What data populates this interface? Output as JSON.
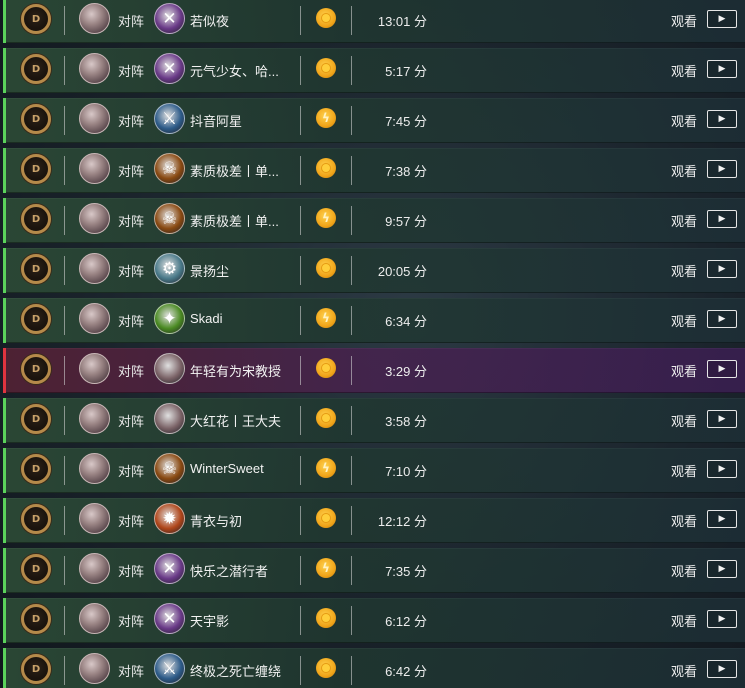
{
  "matches": [
    {
      "vs": "对阵",
      "opponent": "若似夜",
      "hero_icon": "crossed-blades-icon",
      "hero_glyph": "✕",
      "hero_color": "#6a3a88",
      "currency_icon": "gold-coin-icon",
      "duration": "13:01 分",
      "watch": "观看",
      "play": "▶",
      "result": "win"
    },
    {
      "vs": "对阵",
      "opponent": "元气少女、哈...",
      "hero_icon": "crossed-blades-icon",
      "hero_glyph": "✕",
      "hero_color": "#6a3a88",
      "currency_icon": "gold-coin-icon",
      "duration": "5:17 分",
      "watch": "观看",
      "play": "▶",
      "result": "win"
    },
    {
      "vs": "对阵",
      "opponent": "抖音阿星",
      "hero_icon": "sword-icon",
      "hero_glyph": "⚔",
      "hero_color": "#2e5c8a",
      "currency_icon": "flame-coin-icon",
      "duration": "7:45 分",
      "watch": "观看",
      "play": "▶",
      "result": "win"
    },
    {
      "vs": "对阵",
      "opponent": "素质极差丨单...",
      "hero_icon": "demon-mask-icon",
      "hero_glyph": "☠",
      "hero_color": "#8a4a12",
      "currency_icon": "gold-coin-icon",
      "duration": "7:38 分",
      "watch": "观看",
      "play": "▶",
      "result": "win"
    },
    {
      "vs": "对阵",
      "opponent": "素质极差丨单...",
      "hero_icon": "demon-mask-icon",
      "hero_glyph": "☠",
      "hero_color": "#8a4a12",
      "currency_icon": "flame-coin-icon",
      "duration": "9:57 分",
      "watch": "观看",
      "play": "▶",
      "result": "win"
    },
    {
      "vs": "对阵",
      "opponent": "景扬尘",
      "hero_icon": "mech-icon",
      "hero_glyph": "⚙",
      "hero_color": "#4a7a8a",
      "currency_icon": "gold-coin-icon",
      "duration": "20:05 分",
      "watch": "观看",
      "play": "▶",
      "result": "win"
    },
    {
      "vs": "对阵",
      "opponent": "Skadi",
      "hero_icon": "green-spell-icon",
      "hero_glyph": "✦",
      "hero_color": "#4a8a22",
      "currency_icon": "flame-coin-icon",
      "duration": "6:34 分",
      "watch": "观看",
      "play": "▶",
      "result": "win"
    },
    {
      "vs": "对阵",
      "opponent": "年轻有为宋教授",
      "hero_icon": "portrait-icon",
      "hero_glyph": "",
      "hero_color": "#7a6266",
      "currency_icon": "gold-coin-icon",
      "duration": "3:29 分",
      "watch": "观看",
      "play": "▶",
      "result": "loss"
    },
    {
      "vs": "对阵",
      "opponent": "大红花丨王大夫",
      "hero_icon": "portrait-icon",
      "hero_glyph": "",
      "hero_color": "#7a6266",
      "currency_icon": "gold-coin-icon",
      "duration": "3:58 分",
      "watch": "观看",
      "play": "▶",
      "result": "win"
    },
    {
      "vs": "对阵",
      "opponent": "WinterSweet",
      "hero_icon": "demon-mask-icon",
      "hero_glyph": "☠",
      "hero_color": "#8a4a12",
      "currency_icon": "flame-coin-icon",
      "duration": "7:10 分",
      "watch": "观看",
      "play": "▶",
      "result": "win"
    },
    {
      "vs": "对阵",
      "opponent": "青衣与初",
      "hero_icon": "fire-icon",
      "hero_glyph": "✹",
      "hero_color": "#b0461a",
      "currency_icon": "gold-coin-icon",
      "duration": "12:12 分",
      "watch": "观看",
      "play": "▶",
      "result": "win"
    },
    {
      "vs": "对阵",
      "opponent": "快乐之潜行者",
      "hero_icon": "crossed-blades-icon",
      "hero_glyph": "✕",
      "hero_color": "#6a3a88",
      "currency_icon": "flame-coin-icon",
      "duration": "7:35 分",
      "watch": "观看",
      "play": "▶",
      "result": "win"
    },
    {
      "vs": "对阵",
      "opponent": "天宇影",
      "hero_icon": "crossed-blades-icon",
      "hero_glyph": "✕",
      "hero_color": "#6a3a88",
      "currency_icon": "gold-coin-icon",
      "duration": "6:12 分",
      "watch": "观看",
      "play": "▶",
      "result": "win"
    },
    {
      "vs": "对阵",
      "opponent": "终极之死亡缠绕",
      "hero_icon": "sword-icon",
      "hero_glyph": "⚔",
      "hero_color": "#2e5c8a",
      "currency_icon": "gold-coin-icon",
      "duration": "6:42 分",
      "watch": "观看",
      "play": "▶",
      "result": "win"
    }
  ],
  "badge_text": "D",
  "win_color": "#5bd25b",
  "loss_color": "#e0343f"
}
